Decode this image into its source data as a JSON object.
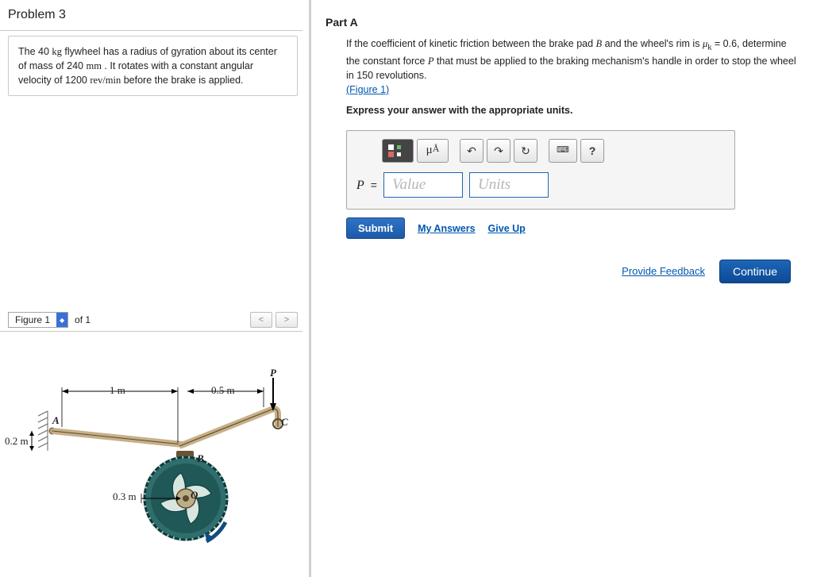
{
  "problem": {
    "title": "Problem 3",
    "description_html": "The 40 kg flywheel has a radius of gyration about its center of mass of 240 mm . It rotates with a constant angular velocity of 1200 rev/min before the brake is applied."
  },
  "figure": {
    "selector_label": "Figure 1",
    "of_text": "of 1",
    "nav_prev": "<",
    "nav_next": ">",
    "labels": {
      "P": "P",
      "A": "A",
      "B": "B",
      "C": "C",
      "O": "O",
      "d1": "1 m",
      "d2": "0.5 m",
      "h": "0.2 m",
      "r": "0.3 m"
    }
  },
  "part": {
    "title": "Part A",
    "prompt_prefix": "If the coefficient of kinetic friction between the brake pad ",
    "prompt_B": "B",
    "prompt_mid": " and the wheel's rim is ",
    "mu_text": "μk = 0.6",
    "prompt_cont": ", determine the constant force ",
    "prompt_P": "P",
    "prompt_tail": " that must be applied to the braking mechanism's handle in order to stop the wheel in 150 revolutions.",
    "figure_link": "(Figure 1)",
    "instruction": "Express your answer with the appropriate units.",
    "toolbar": {
      "special_chars": "μÅ",
      "undo": "↶",
      "redo": "↷",
      "reset": "↻",
      "keyboard": "⌨",
      "help": "?"
    },
    "answer": {
      "var": "P",
      "equals": "=",
      "value_placeholder": "Value",
      "units_placeholder": "Units"
    },
    "actions": {
      "submit": "Submit",
      "my_answers": "My Answers",
      "give_up": "Give Up"
    }
  },
  "footer": {
    "feedback": "Provide Feedback",
    "continue": "Continue"
  }
}
